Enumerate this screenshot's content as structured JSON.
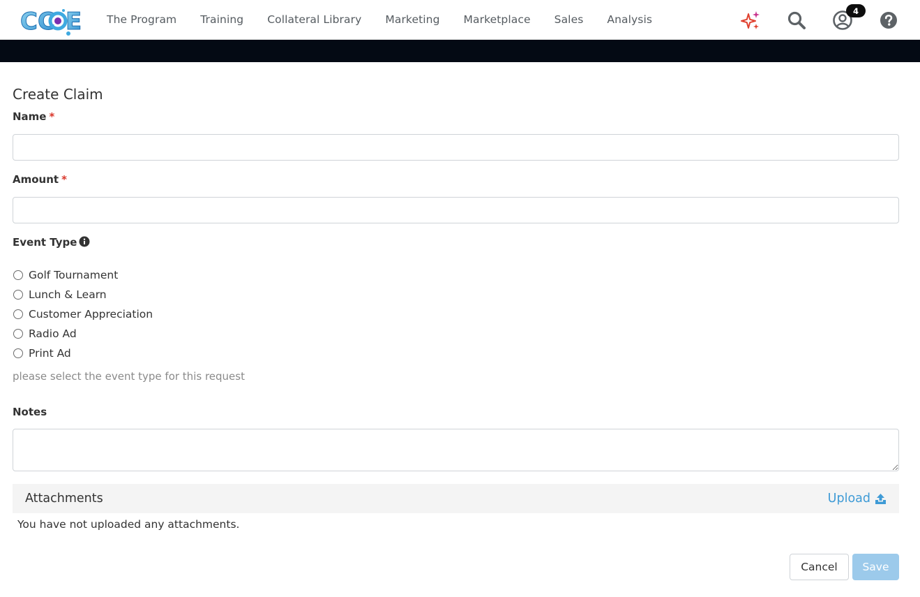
{
  "brand": {
    "logo_text": "CCOE"
  },
  "nav": {
    "items": [
      "The Program",
      "Training",
      "Collateral Library",
      "Marketing",
      "Marketplace",
      "Sales",
      "Analysis"
    ]
  },
  "header_icons": {
    "ai": "sparkles-icon",
    "search": "search-icon",
    "user": "user-circle-icon",
    "help": "question-circle-icon",
    "notification_count": "4"
  },
  "form": {
    "title": "Create Claim",
    "name": {
      "label": "Name",
      "required_mark": "*",
      "value": ""
    },
    "amount": {
      "label": "Amount",
      "required_mark": "*",
      "value": ""
    },
    "event_type": {
      "label": "Event Type",
      "options": [
        "Golf Tournament",
        "Lunch & Learn",
        "Customer Appreciation",
        "Radio Ad",
        "Print Ad"
      ],
      "help_text": "please select the event type for this request"
    },
    "notes": {
      "label": "Notes",
      "value": ""
    },
    "attachments": {
      "title": "Attachments",
      "upload_label": "Upload",
      "empty_text": "You have not uploaded any attachments."
    },
    "actions": {
      "cancel_label": "Cancel",
      "save_label": "Save"
    }
  },
  "colors": {
    "accent": "#3f9bd6",
    "save_disabled": "#9ccaeb",
    "required": "#d9372b",
    "dark_band": "#040a14"
  }
}
